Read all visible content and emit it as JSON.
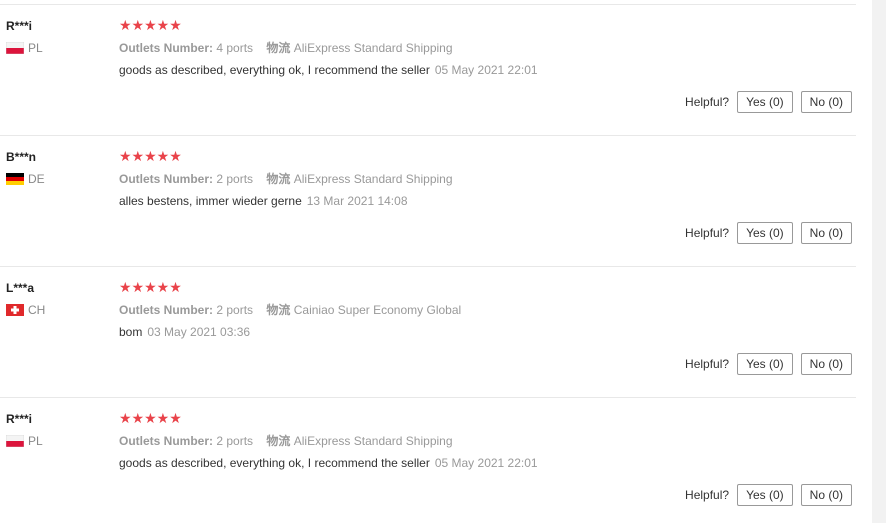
{
  "reviews": [
    {
      "user": "R***i",
      "country": "PL",
      "flag": "poland-flag-icon",
      "rating": 5,
      "stars": "★★★★★",
      "outlets_label": "Outlets Number:",
      "outlets_value": "4 ports",
      "shipping_label": "物流",
      "shipping_value": "AliExpress Standard Shipping",
      "text": "goods as described, everything ok, I recommend the seller",
      "date": "05 May 2021 22:01",
      "helpful_label": "Helpful?",
      "yes": "Yes (0)",
      "no": "No (0)"
    },
    {
      "user": "B***n",
      "country": "DE",
      "flag": "germany-flag-icon",
      "rating": 5,
      "stars": "★★★★★",
      "outlets_label": "Outlets Number:",
      "outlets_value": "2 ports",
      "shipping_label": "物流",
      "shipping_value": "AliExpress Standard Shipping",
      "text": "alles bestens, immer wieder gerne",
      "date": "13 Mar 2021 14:08",
      "helpful_label": "Helpful?",
      "yes": "Yes (0)",
      "no": "No (0)"
    },
    {
      "user": "L***a",
      "country": "CH",
      "flag": "switzerland-flag-icon",
      "rating": 5,
      "stars": "★★★★★",
      "outlets_label": "Outlets Number:",
      "outlets_value": "2 ports",
      "shipping_label": "物流",
      "shipping_value": "Cainiao Super Economy Global",
      "text": "bom",
      "date": "03 May 2021 03:36",
      "helpful_label": "Helpful?",
      "yes": "Yes (0)",
      "no": "No (0)"
    },
    {
      "user": "R***i",
      "country": "PL",
      "flag": "poland-flag-icon",
      "rating": 5,
      "stars": "★★★★★",
      "outlets_label": "Outlets Number:",
      "outlets_value": "2 ports",
      "shipping_label": "物流",
      "shipping_value": "AliExpress Standard Shipping",
      "text": "goods as described, everything ok, I recommend the seller",
      "date": "05 May 2021 22:01",
      "helpful_label": "Helpful?",
      "yes": "Yes (0)",
      "no": "No (0)"
    }
  ],
  "colors": {
    "star": "#e9434a",
    "muted": "#999999",
    "divider": "#e8e8e8"
  }
}
